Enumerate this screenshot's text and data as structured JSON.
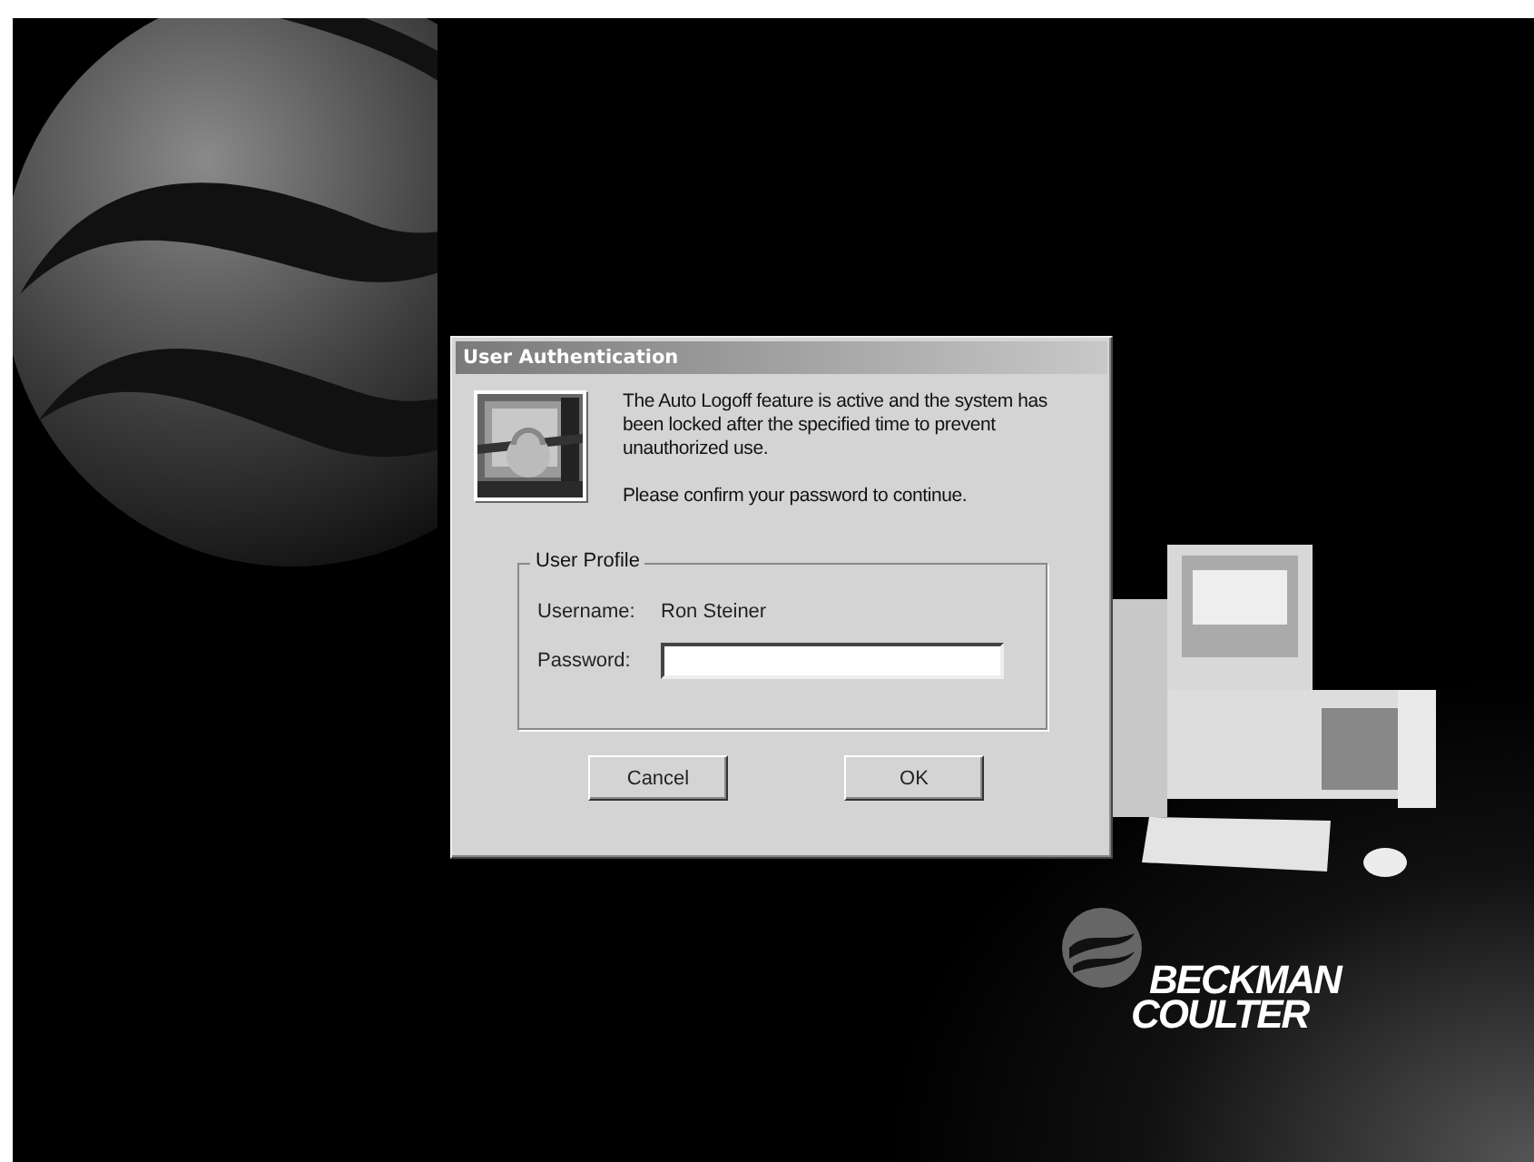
{
  "dialog": {
    "title": "User Authentication",
    "message_lines": [
      "The Auto Logoff feature is active and the system has been locked after the specified time to prevent unauthorized use.",
      "Please confirm your password to continue."
    ],
    "group": {
      "title": "User Profile",
      "fields": [
        {
          "kind": "readonly",
          "label": "Username:",
          "value": "Ron Steiner"
        },
        {
          "kind": "password",
          "label": "Password:"
        }
      ]
    },
    "buttons": [
      "Cancel",
      "OK"
    ]
  },
  "brand": {
    "lines": [
      "BECKMAN",
      "COULTER"
    ]
  }
}
